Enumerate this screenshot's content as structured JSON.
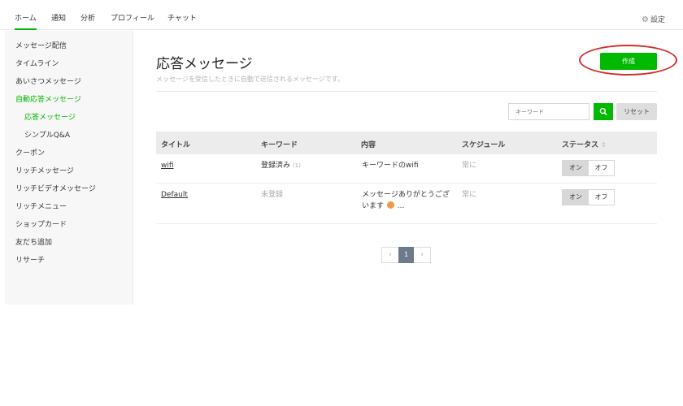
{
  "nav": {
    "tabs": [
      {
        "label": "ホーム"
      },
      {
        "label": "通知"
      },
      {
        "label": "分析"
      },
      {
        "label": "プロフィール"
      },
      {
        "label": "チャット"
      }
    ],
    "settings_label": "設定",
    "settings_icon": "gear-icon"
  },
  "sidebar": {
    "items": [
      {
        "label": "メッセージ配信"
      },
      {
        "label": "タイムライン"
      },
      {
        "label": "あいさつメッセージ"
      },
      {
        "label": "自動応答メッセージ"
      },
      {
        "label": "応答メッセージ"
      },
      {
        "label": "シンプルQ&A"
      },
      {
        "label": "クーポン"
      },
      {
        "label": "リッチメッセージ"
      },
      {
        "label": "リッチビデオメッセージ"
      },
      {
        "label": "リッチメニュー"
      },
      {
        "label": "ショップカード"
      },
      {
        "label": "友だち追加"
      },
      {
        "label": "リサーチ"
      }
    ]
  },
  "main": {
    "title": "応答メッセージ",
    "description": "メッセージを受信したときに自動で送信されるメッセージです。",
    "create_label": "作成",
    "search": {
      "placeholder": "キーワード",
      "icon": "search-icon",
      "reset_label": "リセット"
    },
    "table": {
      "headers": [
        "タイトル",
        "キーワード",
        "内容",
        "スケジュール",
        "ステータス"
      ],
      "sort_icon": "sort-icon",
      "rows": [
        {
          "title": "wifi",
          "keyword": "登録済み",
          "keyword_count": "(1)",
          "content": "キーワードのwifi",
          "content_line2": "",
          "schedule": "常に",
          "on_label": "オン",
          "off_label": "オフ"
        },
        {
          "title": "Default",
          "keyword": "未登録",
          "keyword_count": "",
          "content": "メッセージありがとうござ",
          "content_line2": "います",
          "content_suffix": "...",
          "schedule": "常に",
          "on_label": "オン",
          "off_label": "オフ"
        }
      ]
    },
    "pagination": {
      "prev": "‹",
      "current": "1",
      "next": "›"
    }
  },
  "colors": {
    "accent": "#00b900",
    "highlight": "#d0302a",
    "pager_active": "#6b7b8c"
  }
}
